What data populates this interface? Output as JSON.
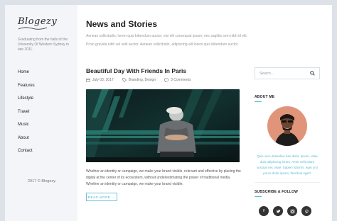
{
  "sidebar": {
    "logo": "Blogezy",
    "tagline": "Graduating from the halls of the University Of Western Sydney in late 2011.",
    "nav": [
      "Home",
      "Features",
      "Lifestyle",
      "Travel",
      "Music",
      "About",
      "Contact"
    ],
    "copyright": "2017 © Blogezy."
  },
  "main": {
    "title": "News and Stories",
    "description": "Aenean sollicitudin, lorem quis bibendum auctor, nisi elit consequat ipsum, nec sagittis sem nibh id elit. Proin gravida nibh vel velit auctor. Aenean sollicitudin, adipiscing elit lorem quis bibendum auctor."
  },
  "post": {
    "title": "Beautiful Day With Friends In Paris",
    "date": "July 03, 2017",
    "categories": "Branding, Design",
    "comments": "3 Comments",
    "excerpt": "Whether an identity or campaign, we make your brand visible, relevant and effective by placing the digital at the center of its ecosystem, without underestimating the power of traditional media. Whether an identity or campaign, we make your brand visible.",
    "read_more": "READ MORE →"
  },
  "widgets": {
    "search_placeholder": "Search...",
    "about_title": "ABOUT ME",
    "about_text": "Quis vero phasellus hac dolor, ipsum, vitae duis adipiscing lorem. Amet velit etiam suscipit nec vitae. Sapien lobortis, eget orci purus dolor ipsum, faucibus eget?",
    "subscribe_title": "SUBSCRIBE & FOLLOW",
    "socials": [
      "facebook-icon",
      "twitter-icon",
      "instagram-icon",
      "pinterest-icon"
    ]
  },
  "colors": {
    "accent": "#5bbad2",
    "sidebar_bg": "#f3f5f8",
    "social_bg": "#333333"
  }
}
